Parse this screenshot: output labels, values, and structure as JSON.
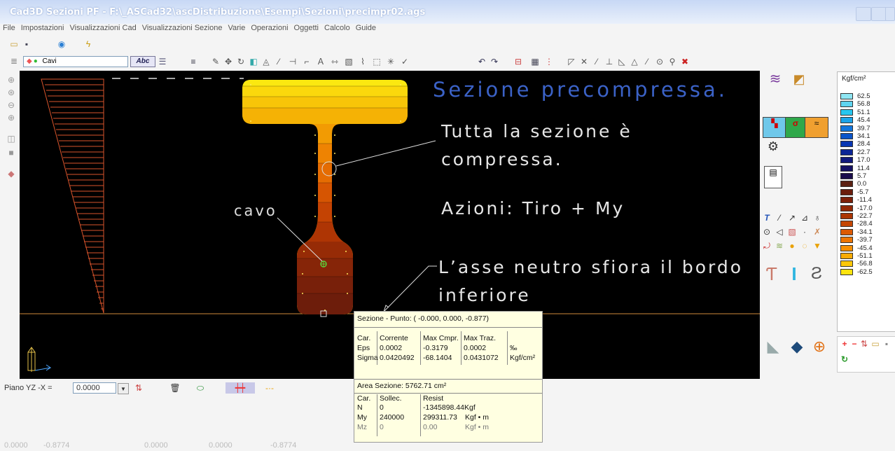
{
  "window": {
    "title": "Cad3D Sezioni PF - F:\\_ASCad32\\ascDistribuzione\\Esempi\\Sezioni\\precimpr02.ags"
  },
  "menu": [
    "File",
    "Impostazioni",
    "Visualizzazioni Cad",
    "Visualizzazioni Sezione",
    "Varie",
    "Operazioni",
    "Oggetti",
    "Calcolo",
    "Guide"
  ],
  "layer": {
    "selected": "Cavi"
  },
  "toolbar_text": {
    "abc": "Abc"
  },
  "canvas": {
    "title": "Sezione precompressa.",
    "note1_line1": "Tutta la sezione è",
    "note1_line2": "compressa.",
    "note2": "Azioni:   Tiro + My",
    "label_cavo": "cavo",
    "note3_line1": "L’asse neutro sfiora il bordo",
    "note3_line2": "inferiore"
  },
  "colors": {
    "title": "#3b62c7",
    "canvas_bg": "#000000",
    "axis": "#d08a3a",
    "diagram": "#d9542b"
  },
  "legend": {
    "unit": "Kgf/cm²",
    "items": [
      {
        "v": "62.5",
        "c": "#8fe6f3"
      },
      {
        "v": "56.8",
        "c": "#5fd4f0"
      },
      {
        "v": "51.1",
        "c": "#27c6ef"
      },
      {
        "v": "45.4",
        "c": "#1ca3e8"
      },
      {
        "v": "39.7",
        "c": "#1276dd"
      },
      {
        "v": "34.1",
        "c": "#0a54c9"
      },
      {
        "v": "28.4",
        "c": "#0937b3"
      },
      {
        "v": "22.7",
        "c": "#0c2596"
      },
      {
        "v": "17.0",
        "c": "#11197c"
      },
      {
        "v": "11.4",
        "c": "#161263"
      },
      {
        "v": "5.7",
        "c": "#1a0d4c"
      },
      {
        "v": "0.0",
        "c": "#5b2113"
      },
      {
        "v": "-5.7",
        "c": "#6b1d0c"
      },
      {
        "v": "-11.4",
        "c": "#7d1f08"
      },
      {
        "v": "-17.0",
        "c": "#922806"
      },
      {
        "v": "-22.7",
        "c": "#ab3604"
      },
      {
        "v": "-28.4",
        "c": "#c44603"
      },
      {
        "v": "-34.1",
        "c": "#dc5a02"
      },
      {
        "v": "-39.7",
        "c": "#ec7402"
      },
      {
        "v": "-45.4",
        "c": "#f58f03"
      },
      {
        "v": "-51.1",
        "c": "#f9ab06"
      },
      {
        "v": "-56.8",
        "c": "#fcc70a"
      },
      {
        "v": "-62.5",
        "c": "#fde40f"
      }
    ]
  },
  "bottombar": {
    "plane_label": "Piano YZ -X =",
    "plane_value": "0.0000"
  },
  "popup": {
    "title": "Sezione - Punto: ( -0.000,  0.000, -0.877)",
    "t1": {
      "h": [
        "Car.",
        "Corrente",
        "Max Cmpr.",
        "Max Traz.",
        ""
      ],
      "eps": [
        "Eps",
        "0.0002",
        "-0.3179",
        "0.0002",
        "‰"
      ],
      "sigma": [
        "Sigma",
        "0.0420492",
        "-68.1404",
        "0.0431072",
        "Kgf/cm²"
      ]
    },
    "area": "Area Sezione: 5762.71 cm²",
    "t2": {
      "h": [
        "Car.",
        "Sollec.",
        "Resist"
      ],
      "n": [
        "N",
        "0",
        "-1345898.44Kgf"
      ],
      "my": [
        "My",
        "240000",
        "299311.73",
        "Kgf • m"
      ],
      "mz": [
        "Mz",
        "0",
        "0.00",
        "Kgf • m"
      ]
    }
  },
  "status": [
    "0.0000",
    "-0.8774",
    "0.0000",
    "0.0000",
    "-0.8774"
  ]
}
